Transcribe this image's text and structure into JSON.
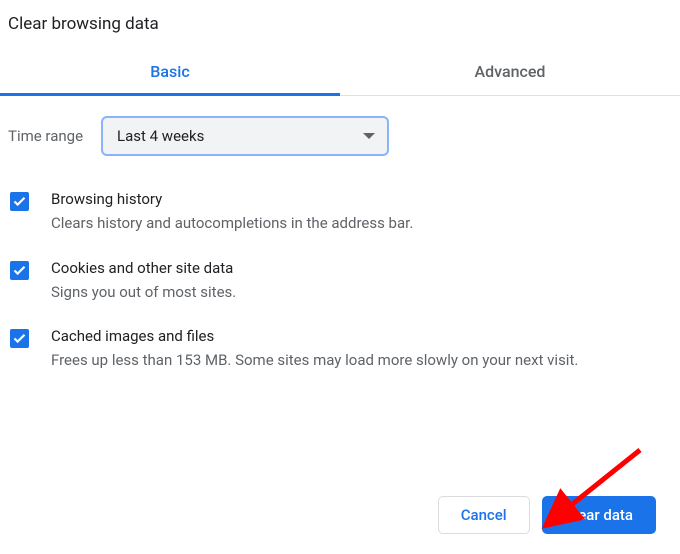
{
  "title": "Clear browsing data",
  "tabs": {
    "basic": "Basic",
    "advanced": "Advanced"
  },
  "timeRange": {
    "label": "Time range",
    "value": "Last 4 weeks"
  },
  "options": {
    "history": {
      "label": "Browsing history",
      "desc": "Clears history and autocompletions in the address bar."
    },
    "cookies": {
      "label": "Cookies and other site data",
      "desc": "Signs you out of most sites."
    },
    "cache": {
      "label": "Cached images and files",
      "desc": "Frees up less than 153 MB. Some sites may load more slowly on your next visit."
    }
  },
  "buttons": {
    "cancel": "Cancel",
    "clear": "Clear data"
  }
}
